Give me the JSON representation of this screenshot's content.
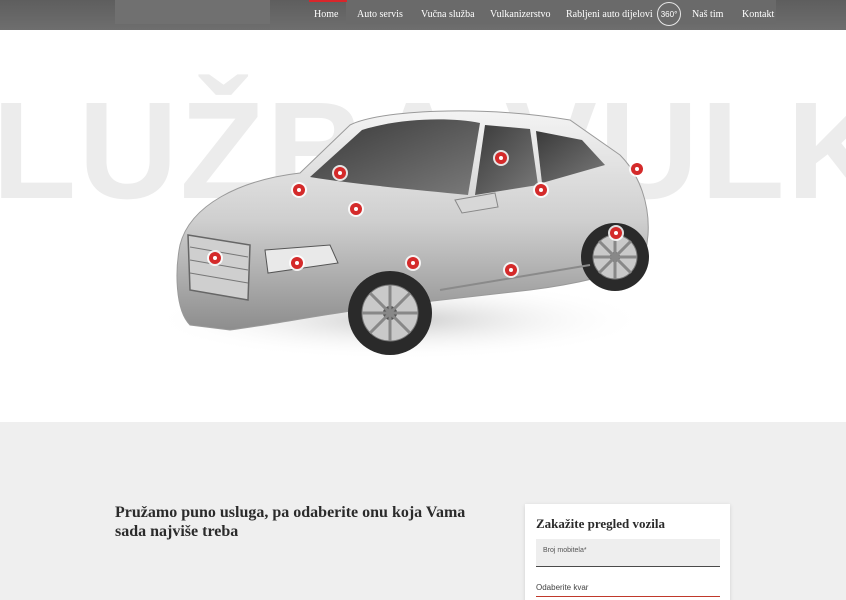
{
  "nav": {
    "items": [
      {
        "label": "Home",
        "active": true
      },
      {
        "label": "Auto servis"
      },
      {
        "label": "Vučna služba"
      },
      {
        "label": "Vulkanizerstvo"
      },
      {
        "label": "Rabljeni auto dijelovi"
      },
      {
        "label": "Naš tim"
      },
      {
        "label": "Kontakt"
      }
    ],
    "badge_360": "360°",
    "accent_color": "#d8262b"
  },
  "hero": {
    "background_word": "LUŽBA VULK",
    "car_image": "silver sedan with red hotspot markers",
    "hotspot_icon": "red-dot-hotspot-icon"
  },
  "services": {
    "lead_text": "Pružamo puno usluga, pa odaberite onu koja Vama sada najviše treba"
  },
  "booking_form": {
    "title": "Zakažite pregled vozila",
    "phone_placeholder": "Broj mobitela*",
    "issue_placeholder": "Odaberite kvar"
  }
}
